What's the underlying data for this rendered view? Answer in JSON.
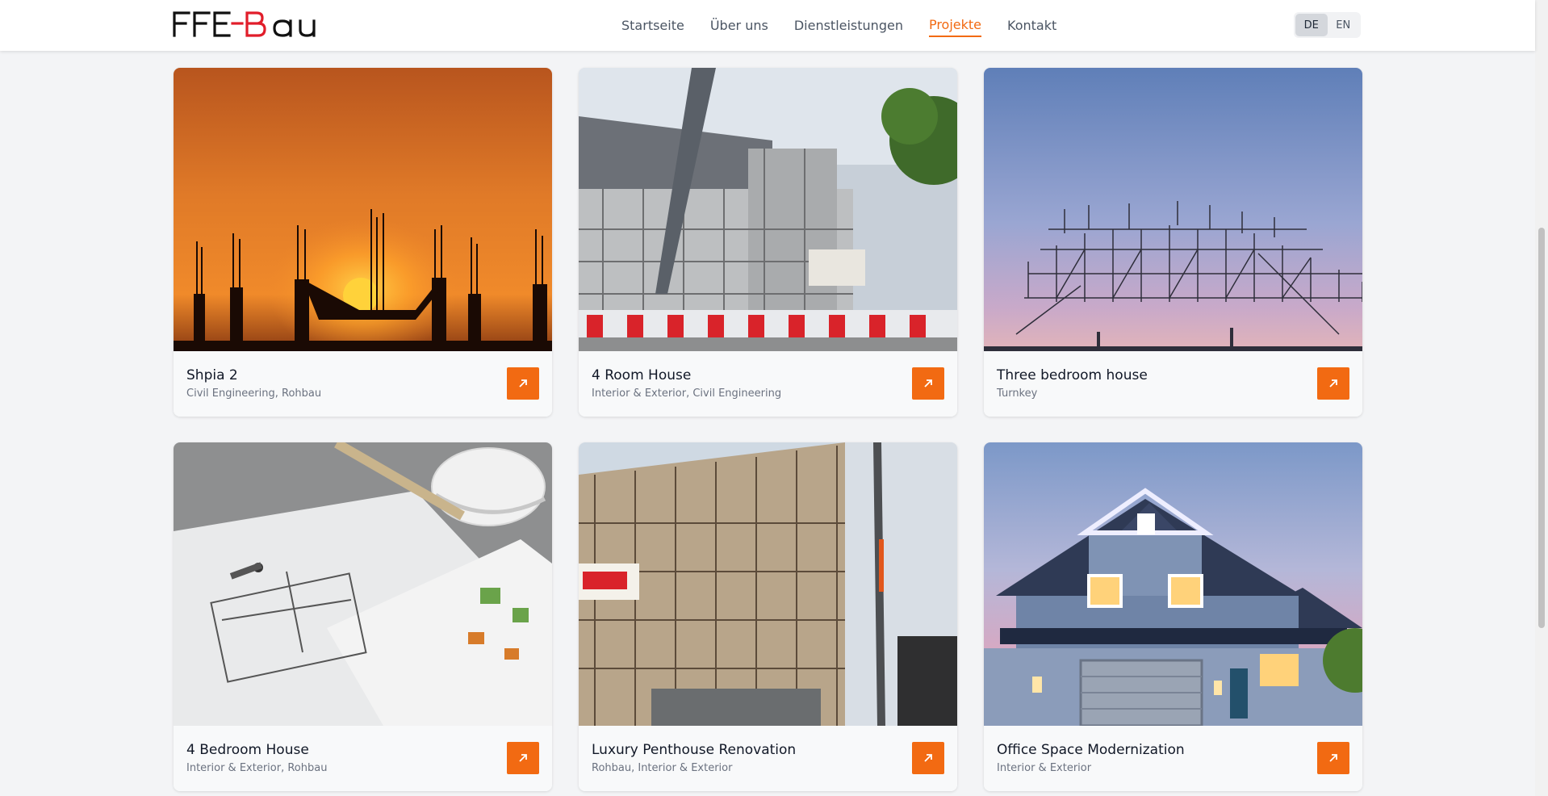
{
  "brand": {
    "logo_text": "FFE-BAU",
    "accent": "#f26a12"
  },
  "nav": {
    "items": [
      {
        "label": "Startseite",
        "active": false
      },
      {
        "label": "Über uns",
        "active": false
      },
      {
        "label": "Dienstleistungen",
        "active": false
      },
      {
        "label": "Projekte",
        "active": true
      },
      {
        "label": "Kontakt",
        "active": false
      }
    ]
  },
  "lang": {
    "options": [
      "DE",
      "EN"
    ],
    "selected": "DE"
  },
  "projects": [
    {
      "title": "Shpia 2",
      "categories": "Civil Engineering, Rohbau",
      "image": "sunset-construction-silhouette"
    },
    {
      "title": "4 Room House",
      "categories": "Interior & Exterior, Civil Engineering",
      "image": "scaffolded-building"
    },
    {
      "title": "Three bedroom house",
      "categories": "Turnkey",
      "image": "scaffold-frame-sky"
    },
    {
      "title": "4 Bedroom House",
      "categories": "Interior & Exterior, Rohbau",
      "image": "blueprints-helmet"
    },
    {
      "title": "Luxury Penthouse Renovation",
      "categories": "Rohbau, Interior & Exterior",
      "image": "facade-scaffolding"
    },
    {
      "title": "Office Space Modernization",
      "categories": "Interior & Exterior",
      "image": "modern-house-dusk"
    }
  ],
  "icons": {
    "card_link": "arrow-up-right-icon"
  }
}
